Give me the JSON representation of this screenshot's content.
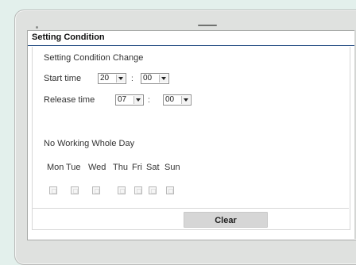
{
  "panel": {
    "title": "Setting Condition"
  },
  "setting": {
    "change_label": "Setting Condition Change",
    "start_time": {
      "label": "Start time",
      "hour": "20",
      "minute": "00"
    },
    "release_time": {
      "label": "Release time",
      "hour": "07",
      "minute": "00"
    },
    "no_working_label": "No Working Whole Day",
    "days": [
      "Mon",
      "Tue",
      "Wed",
      "Thu",
      "Fri",
      "Sat",
      "Sun"
    ]
  },
  "actions": {
    "clear_label": "Clear"
  }
}
